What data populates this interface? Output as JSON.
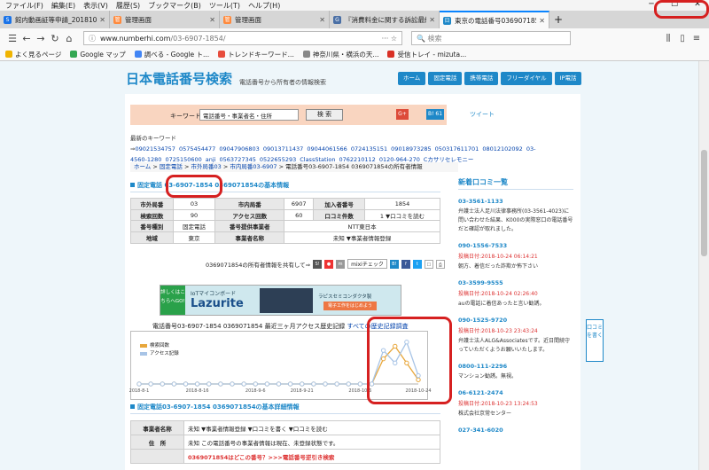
{
  "menu": [
    "ファイル(F)",
    "編集(E)",
    "表示(V)",
    "履歴(S)",
    "ブックマーク(B)",
    "ツール(T)",
    "ヘルプ(H)"
  ],
  "tabs": [
    {
      "title": "館内動画証等申請_20181023 - Sh",
      "color": "#1a73e8",
      "glyph": "S"
    },
    {
      "title": "管理画面",
      "color": "#ff8a3d",
      "glyph": "管"
    },
    {
      "title": "管理画面",
      "color": "#ff8a3d",
      "glyph": "管"
    },
    {
      "title": "『消費料金に関する訴訟最終通",
      "color": "#4a6fa5",
      "glyph": "G"
    },
    {
      "title": "東京の電話番号0369071854 03-6",
      "color": "#1e88c8",
      "glyph": "日",
      "active": true
    }
  ],
  "nav": {
    "url_host": "www.numberhi.com",
    "url_path": "/03-6907-1854/",
    "search_placeholder": "検索"
  },
  "bookmarks": [
    {
      "label": "よく見るページ",
      "color": "#f0b400"
    },
    {
      "label": "Google マップ",
      "color": "#34a853"
    },
    {
      "label": "調べる - Google ト...",
      "color": "#4285f4"
    },
    {
      "label": "トレンドキーワード...",
      "color": "#e74c3c"
    },
    {
      "label": "神奈川県・横浜の天...",
      "color": "#888888"
    },
    {
      "label": "受信トレイ - mizuta...",
      "color": "#d93025"
    }
  ],
  "site": {
    "title": "日本電話番号検索",
    "subtitle": "電話番号から所有者の情報検索",
    "topnav": [
      "ホーム",
      "固定電話",
      "携帯電話",
      "フリーダイヤル",
      "IP電話"
    ]
  },
  "search": {
    "label": "キーワード",
    "input_value": "電話番号・事業者名・住所",
    "button": "検 索",
    "gplus": "G+",
    "bshare": "B! 61",
    "tweet": "ツイート"
  },
  "recent": {
    "label": "最新のキーワード⇒",
    "items": [
      "09021534757",
      "0575454477",
      "09047906803",
      "09013711437",
      "09044061566",
      "0724135151",
      "09018973285",
      "050317611701",
      "08012102092",
      "03-4560-1280",
      "0725150600",
      "anji",
      "0563727345",
      "0522655293",
      "ClassStation",
      "0762210112",
      "0120-964-270",
      "Cカサリセレモニー"
    ]
  },
  "breadcrumb": [
    "ホーム",
    "固定電話",
    "市外局番03",
    "市内局番03-6907",
    "電話番号03-6907-1854 0369071854の所有者情報"
  ],
  "basic": {
    "prefix": "固定電話",
    "number": "03-6907-1854",
    "suffix": " 0369071854の基本情報"
  },
  "info_rows": [
    [
      "市外局番",
      "03",
      "市内局番",
      "6907",
      "加入者番号",
      "1854"
    ],
    [
      "検索回数",
      "90",
      "アクセス回数",
      "60",
      "口コミ件数",
      "1 ▼口コミを読む"
    ],
    [
      "番号種別",
      "固定電話",
      "番号提供事業者",
      "NTT東日本"
    ],
    [
      "地域",
      "東京",
      "事業者名称",
      "未知 ▼事業者情報登録"
    ]
  ],
  "share": {
    "text": "0369071854の所有者情報を共有して⇒",
    "mixi": "mixiチェック"
  },
  "banner": {
    "left": "詳しくはこちらへGO!",
    "small": "IoTマイコンボード",
    "big": "Lazurite",
    "right": "ラピスセミコンダクタ製",
    "btn": "電子工作をはじめよう"
  },
  "chart_title_text": "電話番号03-6907-1854 0369071854 最近三ヶ月アクセス歴史記録 ",
  "chart_title_link": "すべての歴史記録調査",
  "chart_data": {
    "type": "line",
    "x": [
      "2018-8-1",
      "2018-8-5",
      "2018-8-9",
      "2018-8-13",
      "2018-8-17",
      "2018-8-21",
      "2018-8-25",
      "2018-8-29",
      "2018-9-2",
      "2018-9-6",
      "2018-9-10",
      "2018-9-14",
      "2018-9-18",
      "2018-9-22",
      "2018-9-26",
      "2018-9-30",
      "2018-10-4",
      "2018-10-8",
      "2018-10-12",
      "2018-10-16",
      "2018-10-20",
      "2018-10-21",
      "2018-10-22",
      "2018-10-23",
      "2018-10-24"
    ],
    "tick_labels": [
      "2018-8-1",
      "2018-8-16",
      "2018-9-6",
      "2018-9-21",
      "2018-10-6",
      "2018-10-24"
    ],
    "series": [
      {
        "name": "検索回数",
        "color": "#e8a73c",
        "values": [
          0,
          0,
          0,
          0,
          0,
          0,
          0,
          0,
          0,
          0,
          0,
          0,
          0,
          0,
          0,
          0,
          0,
          0,
          0,
          0,
          0,
          30,
          45,
          25,
          5
        ]
      },
      {
        "name": "アクセス記録",
        "color": "#a8c4e6",
        "values": [
          0,
          0,
          0,
          0,
          0,
          0,
          0,
          0,
          0,
          0,
          0,
          0,
          0,
          0,
          0,
          0,
          0,
          0,
          0,
          0,
          0,
          40,
          25,
          50,
          10
        ]
      }
    ],
    "ylim": [
      0,
      55
    ]
  },
  "detail": {
    "title_num": "固定電話03-6907-1854 0369071854の基本詳細情報",
    "rows": [
      [
        "事業者名称",
        "未知 ▼事業者情報登録 ▼口コミを書く ▼口コミを読む"
      ],
      [
        "住　所",
        "未知 この電話番号の事業者情報は現在、未登録状態です。"
      ]
    ],
    "ask": "0369071854はどこの番号？>>>電話番号逆引き検索"
  },
  "side": {
    "title": "新着口コミ一覧",
    "items": [
      {
        "num": "03-3561-1133",
        "date": "",
        "text": "弁護士法人足川法律事務所(03-3561-4023)に問い合わせた結果、K000の実際窓口の電話番号だと確認が取れました。"
      },
      {
        "num": "090-1556-7533",
        "date": "投稿日付:2018-10-24 06:14:21",
        "text": "朝方、着信だった詐欺か怖下さい"
      },
      {
        "num": "03-3599-9555",
        "date": "投稿日付:2018-10-24 02:26:40",
        "text": "auの電話に着信あったと言い勧誘。"
      },
      {
        "num": "090-1525-9720",
        "date": "投稿日付:2018-10-23 23:43:24",
        "text": "弁護士法人ALG&Associatesです。近日間続守っていただくようお願いいたします。"
      },
      {
        "num": "0800-111-2296",
        "date": "",
        "text": "マンション勧誘。無視。"
      },
      {
        "num": "06-6121-2474",
        "date": "投稿日付:2018-10-23 13:24:53",
        "text": "株式会社京常センター"
      },
      {
        "num": "027-341-6020",
        "date": "",
        "text": ""
      }
    ]
  },
  "kuchi": "口コミを書く"
}
